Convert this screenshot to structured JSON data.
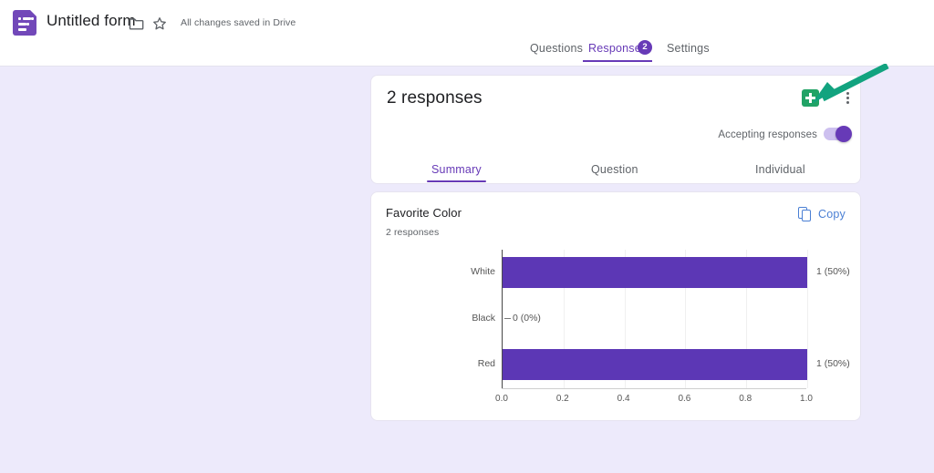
{
  "header": {
    "logo_icon": "google-forms-icon",
    "form_title": "Untitled form",
    "folder_icon": "folder-icon",
    "star_icon": "star-icon",
    "save_status": "All changes saved in Drive"
  },
  "top_tabs": {
    "items": [
      {
        "label": "Questions",
        "active": false
      },
      {
        "label": "Responses",
        "active": true
      },
      {
        "label": "Settings",
        "active": false
      }
    ],
    "responses_badge": "2"
  },
  "summary_card": {
    "response_count_text": "2 responses",
    "sheets_icon": "google-sheets-icon",
    "more_icon": "more-vertical-icon",
    "accepting_label": "Accepting responses",
    "accepting_toggle_state": "on"
  },
  "inner_tabs": {
    "items": [
      {
        "label": "Summary",
        "active": true
      },
      {
        "label": "Question",
        "active": false
      },
      {
        "label": "Individual",
        "active": false
      }
    ]
  },
  "question_card": {
    "title": "Favorite Color",
    "subtitle": "2 responses",
    "copy_label": "Copy",
    "copy_icon": "copy-icon"
  },
  "annotation": {
    "arrow_icon": "green-arrow-icon",
    "color": "#12a37f"
  },
  "colors": {
    "brand_purple": "#673ab7",
    "bar_purple": "#5c37b5",
    "page_background": "#edeafb",
    "sheets_green": "#21a366",
    "copy_blue": "#4a7fd4"
  },
  "chart_data": {
    "type": "bar",
    "orientation": "horizontal",
    "title": "Favorite Color",
    "categories": [
      "White",
      "Black",
      "Red"
    ],
    "values": [
      1,
      0,
      1
    ],
    "data_labels": [
      "1 (50%)",
      "0 (0%)",
      "1 (50%)"
    ],
    "percentages": [
      50,
      0,
      50
    ],
    "xlabel": "",
    "ylabel": "",
    "xlim": [
      0.0,
      1.0
    ],
    "xticks": [
      "0.0",
      "0.2",
      "0.4",
      "0.6",
      "0.8",
      "1.0"
    ],
    "grid": true,
    "legend": false,
    "total_responses": 2,
    "series_color": "#5c37b5"
  }
}
